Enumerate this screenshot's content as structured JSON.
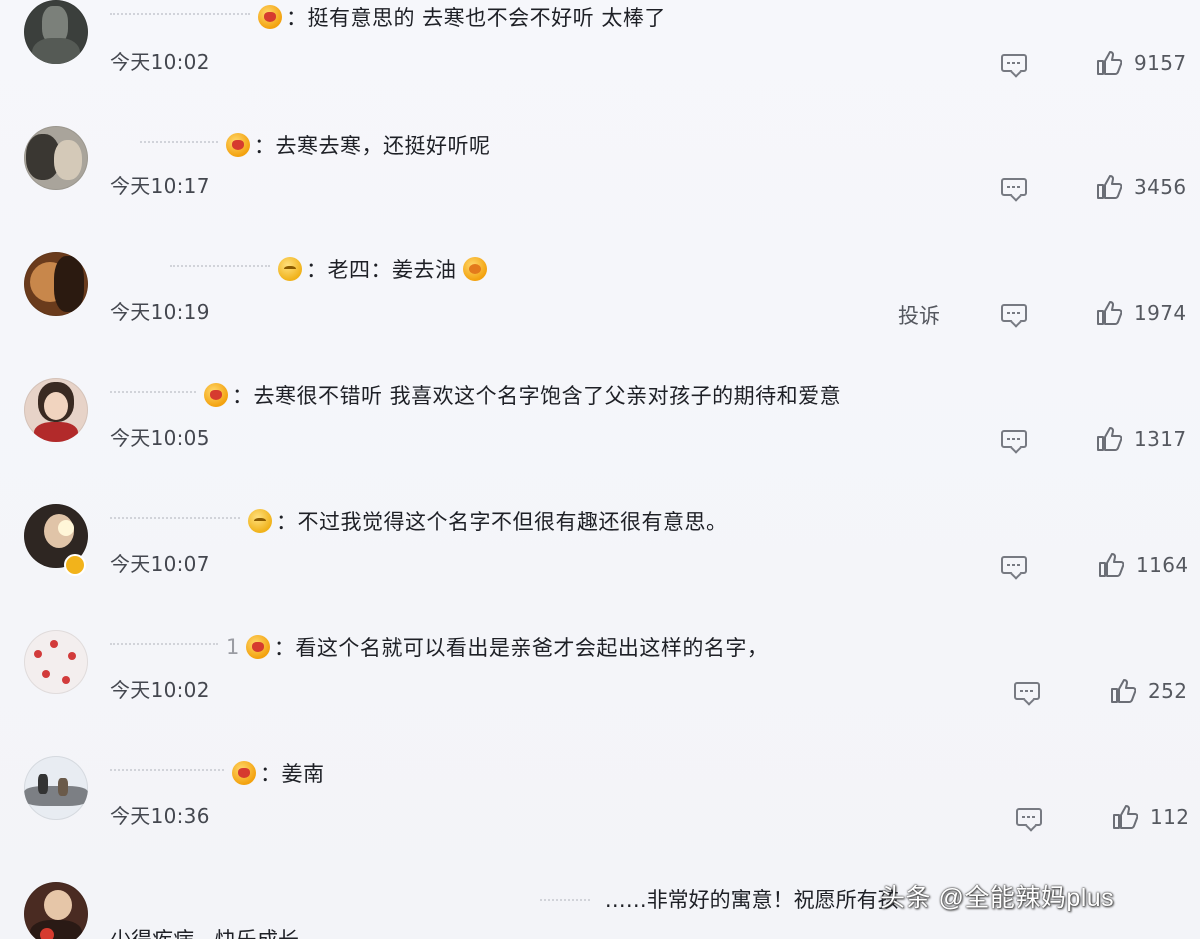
{
  "comments": [
    {
      "text": "：挺有意思的 去寒也不会不好听 太棒了",
      "time": "今天10:02",
      "likes": "9157",
      "report": ""
    },
    {
      "text": "：去寒去寒，还挺好听呢",
      "time": "今天10:17",
      "likes": "3456",
      "report": ""
    },
    {
      "text": "：老四：姜去油",
      "time": "今天10:19",
      "likes": "1974",
      "report": "投诉"
    },
    {
      "text": "：去寒很不错听 我喜欢这个名字饱含了父亲对孩子的期待和爱意",
      "time": "今天10:05",
      "likes": "1317",
      "report": ""
    },
    {
      "text": "：不过我觉得这个名字不但很有趣还很有意思。",
      "time": "今天10:07",
      "likes": "1164",
      "report": ""
    },
    {
      "text": "：看这个名就可以看出是亲爸才会起出这样的名字，",
      "time": "今天10:02",
      "likes": "252",
      "report": ""
    },
    {
      "text": "：姜南",
      "time": "今天10:36",
      "likes": "112",
      "report": ""
    }
  ],
  "last_comment": {
    "text_prefix": "……非常好的寓意！祝愿所有孩",
    "line2": "少得疾病，快乐成长"
  },
  "watermark": "头条 @全能辣妈plus",
  "fragments": {
    "name_suffix_6": "1"
  },
  "colors": {
    "background": "#f4f5f9",
    "text": "#1e2026",
    "meta": "#55585f"
  },
  "icons": {
    "reply": "comment-icon",
    "like": "thumbs-up-icon",
    "badge": "fan-badge-icon"
  }
}
